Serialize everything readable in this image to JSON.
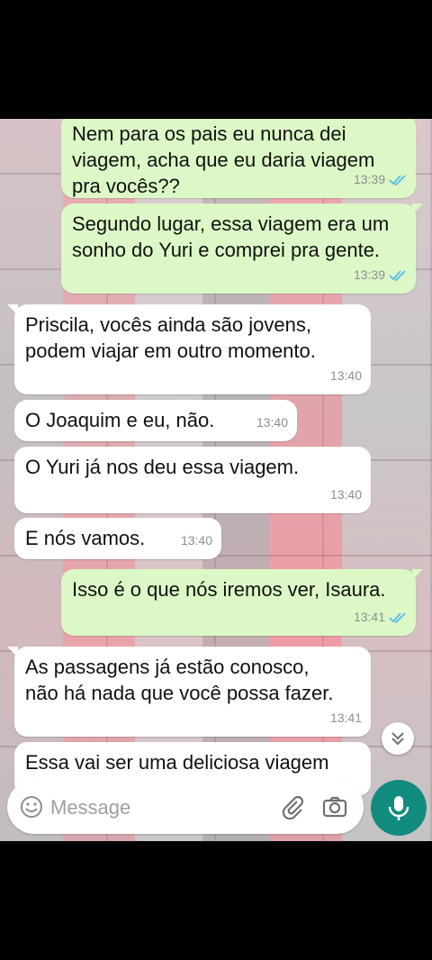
{
  "messages": [
    {
      "text": "Nem para os pais eu nunca dei\nviagem, acha que eu daria viagem\npra vocês??",
      "time": "13:39",
      "direction": "out",
      "read": true
    },
    {
      "text": "Segundo lugar, essa viagem era um\nsonho do Yuri e comprei pra gente.",
      "time": "13:39",
      "direction": "out",
      "read": true
    },
    {
      "text": "Priscila, vocês ainda são jovens,\npodem viajar em outro momento.",
      "time": "13:40",
      "direction": "in"
    },
    {
      "text": "O Joaquim e eu, não.",
      "time": "13:40",
      "direction": "in"
    },
    {
      "text": "O Yuri já nos deu essa viagem.",
      "time": "13:40",
      "direction": "in"
    },
    {
      "text": "E nós vamos.",
      "time": "13:40",
      "direction": "in"
    },
    {
      "text": "Isso é o que nós iremos ver, Isaura.",
      "time": "13:41",
      "direction": "out",
      "read": true
    },
    {
      "text": "As passagens já estão conosco,\nnão há nada que você possa fazer.",
      "time": "13:41",
      "direction": "in"
    },
    {
      "text": "Essa vai ser uma deliciosa viagem",
      "time": "",
      "direction": "in"
    }
  ],
  "input": {
    "placeholder": "Message"
  },
  "colors": {
    "outgoing": "#dcf8c6",
    "incoming": "#ffffff",
    "mic": "#128c7e",
    "read_ticks": "#53bdeb"
  },
  "icons": {
    "emoji": "emoji-icon",
    "attach": "paperclip-icon",
    "camera": "camera-icon",
    "mic": "microphone-icon",
    "scroll": "double-chevron-down-icon"
  }
}
